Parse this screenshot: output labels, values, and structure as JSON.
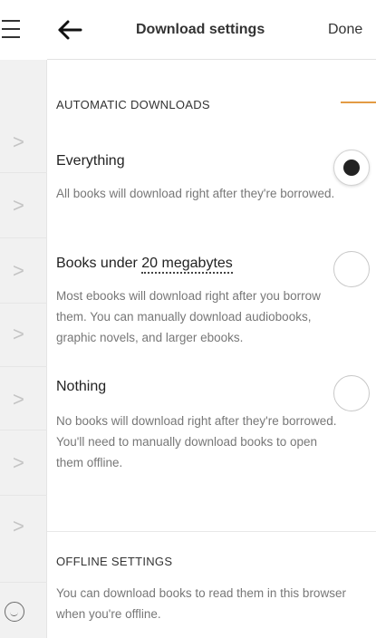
{
  "header": {
    "title": "Download settings",
    "done_label": "Done"
  },
  "automatic_downloads": {
    "section_title": "AUTOMATIC DOWNLOADS",
    "options": [
      {
        "label": "Everything",
        "description": "All books will download right after they're borrowed.",
        "selected": true
      },
      {
        "label_prefix": "Books under ",
        "label_link": "20 megabytes",
        "description": "Most ebooks will download right after you borrow them. You can manually download audiobooks, graphic novels, and larger ebooks.",
        "selected": false
      },
      {
        "label": "Nothing",
        "description": "No books will download right after they're borrowed. You'll need to manually download books to open them offline.",
        "selected": false
      }
    ]
  },
  "offline_settings": {
    "section_title": "OFFLINE SETTINGS",
    "description": "You can download books to read them in this browser when you're offline."
  },
  "icons": {
    "menu": "hamburger-icon",
    "back": "arrow-left-icon",
    "feedback": "smiley-icon",
    "list_chevron": "chevron-right-icon"
  },
  "colors": {
    "accent": "#e39b44",
    "radio_fill": "#222222",
    "muted_text": "#777777"
  }
}
